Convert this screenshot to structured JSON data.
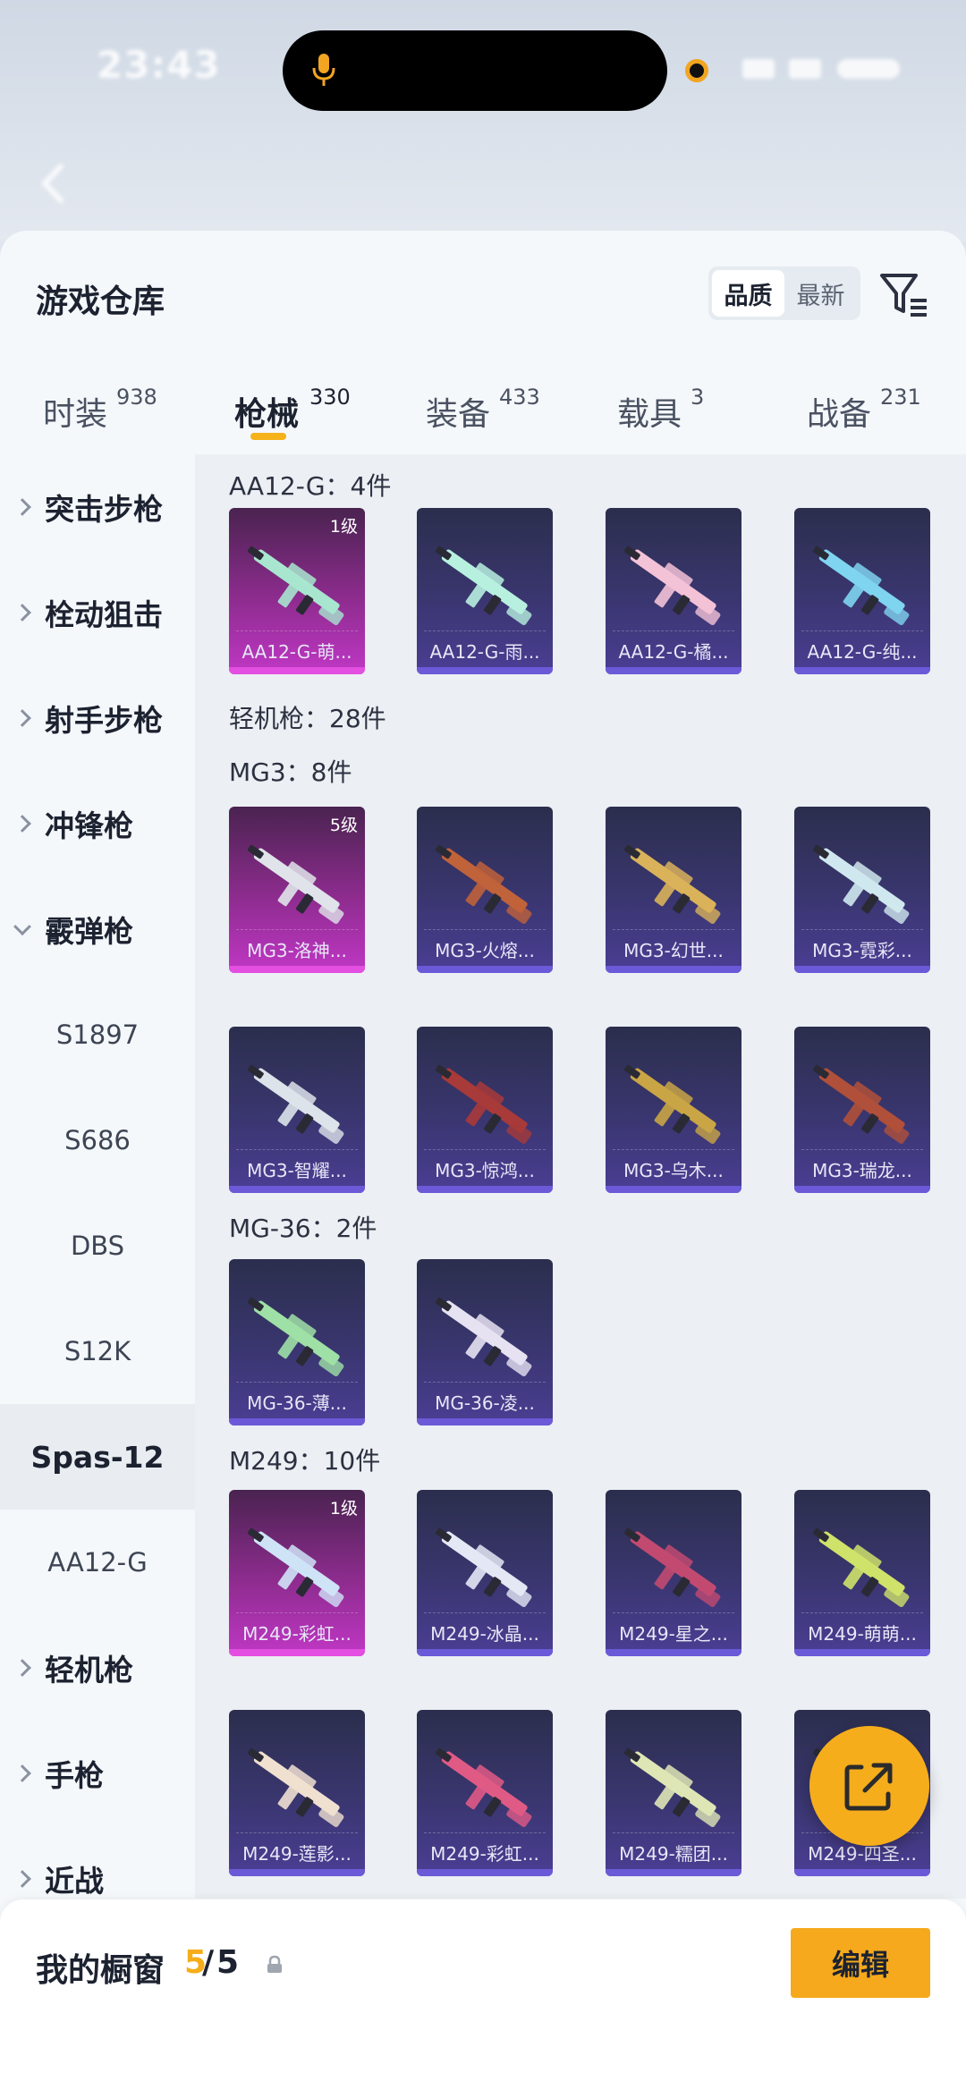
{
  "status_bar": {
    "time": "23:43"
  },
  "sheet": {
    "title": "游戏仓库"
  },
  "sort": {
    "options": [
      "品质",
      "最新"
    ],
    "active": "品质"
  },
  "tabs": [
    {
      "label": "时装",
      "count": "938"
    },
    {
      "label": "枪械",
      "count": "330",
      "active": true
    },
    {
      "label": "装备",
      "count": "433"
    },
    {
      "label": "载具",
      "count": "3"
    },
    {
      "label": "战备",
      "count": "231"
    }
  ],
  "sidebar": {
    "items": [
      {
        "label": "突击步枪",
        "type": "category"
      },
      {
        "label": "栓动狙击",
        "type": "category"
      },
      {
        "label": "射手步枪",
        "type": "category"
      },
      {
        "label": "冲锋枪",
        "type": "category"
      },
      {
        "label": "霰弹枪",
        "type": "category",
        "expanded": true
      },
      {
        "label": "S1897",
        "type": "sub"
      },
      {
        "label": "S686",
        "type": "sub"
      },
      {
        "label": "DBS",
        "type": "sub"
      },
      {
        "label": "S12K",
        "type": "sub"
      },
      {
        "label": "Spas-12",
        "type": "sub",
        "selected": true
      },
      {
        "label": "AA12-G",
        "type": "sub"
      },
      {
        "label": "轻机枪",
        "type": "category"
      },
      {
        "label": "手枪",
        "type": "category"
      },
      {
        "label": "近战",
        "type": "category"
      }
    ]
  },
  "sections": {
    "aa12g": {
      "label": "AA12-G：4件"
    },
    "lmg": {
      "label": "轻机枪：28件"
    },
    "mg3": {
      "label": "MG3：8件"
    },
    "mg36": {
      "label": "MG-36：2件"
    },
    "m249": {
      "label": "M249：10件"
    }
  },
  "cards": {
    "aa12g": [
      {
        "name": "AA12-G-萌...",
        "level": "1级",
        "tier": "gold",
        "gun": "#a8e6cf"
      },
      {
        "name": "AA12-G-雨...",
        "level": "",
        "tier": "purple",
        "gun": "#b8f0e0"
      },
      {
        "name": "AA12-G-橘...",
        "level": "",
        "tier": "purple",
        "gun": "#f4c2d7"
      },
      {
        "name": "AA12-G-纯...",
        "level": "",
        "tier": "purple",
        "gun": "#7fd4f0"
      }
    ],
    "mg3_row1": [
      {
        "name": "MG3-洛神...",
        "level": "5级",
        "tier": "gold",
        "gun": "#e0e4ea"
      },
      {
        "name": "MG3-火熔...",
        "level": "",
        "tier": "purple",
        "gun": "#c0623a"
      },
      {
        "name": "MG3-幻世...",
        "level": "",
        "tier": "purple",
        "gun": "#d9b25a"
      },
      {
        "name": "MG3-霓彩...",
        "level": "",
        "tier": "purple",
        "gun": "#cfe8ef"
      }
    ],
    "mg3_row2": [
      {
        "name": "MG3-智耀...",
        "level": "",
        "tier": "purple",
        "gun": "#dde3ea"
      },
      {
        "name": "MG3-惊鸿...",
        "level": "",
        "tier": "purple",
        "gun": "#a83a3a"
      },
      {
        "name": "MG3-乌木...",
        "level": "",
        "tier": "purple",
        "gun": "#c9a545"
      },
      {
        "name": "MG3-瑞龙...",
        "level": "",
        "tier": "purple",
        "gun": "#b0503a"
      }
    ],
    "mg36": [
      {
        "name": "MG-36-薄...",
        "level": "",
        "tier": "purple",
        "gun": "#9fe0a6"
      },
      {
        "name": "MG-36-凌...",
        "level": "",
        "tier": "purple",
        "gun": "#e6e2f2"
      }
    ],
    "m249_row1": [
      {
        "name": "M249-彩虹...",
        "level": "1级",
        "tier": "gold",
        "gun": "#cfe3f7"
      },
      {
        "name": "M249-冰晶...",
        "level": "",
        "tier": "purple",
        "gun": "#e4e8f5"
      },
      {
        "name": "M249-星之...",
        "level": "",
        "tier": "purple",
        "gun": "#c24a70"
      },
      {
        "name": "M249-萌萌...",
        "level": "",
        "tier": "purple",
        "gun": "#cfe26a"
      }
    ],
    "m249_row2": [
      {
        "name": "M249-莲影...",
        "level": "",
        "tier": "purple",
        "gun": "#f0e0d0"
      },
      {
        "name": "M249-彩虹...",
        "level": "",
        "tier": "purple",
        "gun": "#e05a86"
      },
      {
        "name": "M249-糯团...",
        "level": "",
        "tier": "purple",
        "gun": "#dfe6b5"
      },
      {
        "name": "M249-四圣...",
        "level": "",
        "tier": "purple",
        "gun": "#e8c87a"
      }
    ]
  },
  "bottom": {
    "label": "我的橱窗",
    "count": "5",
    "separator": "/",
    "total": "5",
    "edit_label": "编辑"
  },
  "colors": {
    "accent": "#f5ad1b",
    "card_purple": "#3a3670",
    "card_gold": "#c037c5"
  },
  "icons": [
    "mic-icon",
    "filter-icon",
    "share-icon",
    "lock-icon",
    "chevron-right-icon",
    "chevron-down-icon",
    "back-icon"
  ]
}
